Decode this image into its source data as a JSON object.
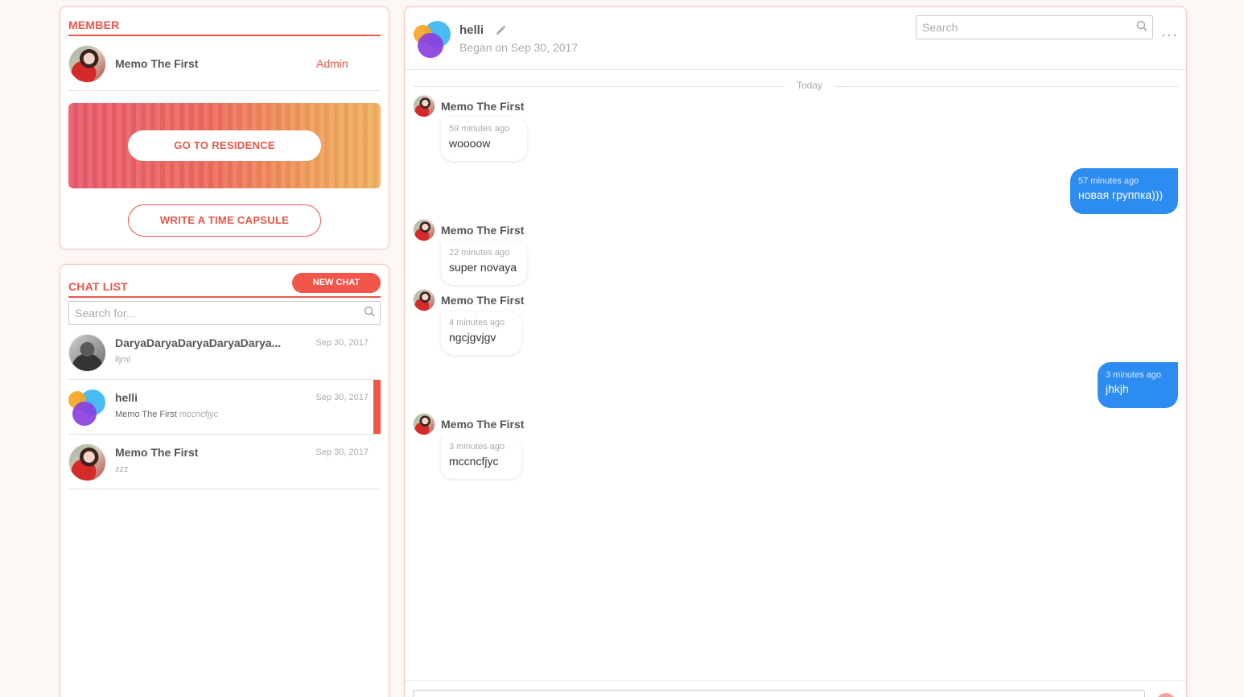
{
  "member": {
    "title": "MEMBER",
    "name": "Memo The First",
    "role": "Admin",
    "residence_button": "GO TO RESIDENCE",
    "time_capsule_button": "WRITE A TIME CAPSULE"
  },
  "chat_list": {
    "title": "CHAT LIST",
    "new_chat": "NEW CHAT",
    "search_placeholder": "Search for...",
    "items": [
      {
        "name": "DaryaDaryaDaryaDaryaDarya...",
        "date": "Sep 30, 2017",
        "sender": "",
        "preview": "lljml"
      },
      {
        "name": "helli",
        "date": "Sep 30, 2017",
        "sender": "Memo The First",
        "preview": "mccncfjyc"
      },
      {
        "name": "Memo The First",
        "date": "Sep 30, 2017",
        "sender": "",
        "preview": "zzz"
      }
    ]
  },
  "chat": {
    "title": "helli",
    "subtitle": "Began on Sep 30, 2017",
    "search_placeholder": "Search",
    "more_icon": "···",
    "day_label": "Today",
    "messages": [
      {
        "sender": "Memo The First",
        "time": "59 minutes ago",
        "text": "woooow"
      },
      {
        "sender": "",
        "time": "57 minutes ago",
        "text": "новая группка)))"
      },
      {
        "sender": "Memo The First",
        "time": "22 minutes ago",
        "text": "super novaya"
      },
      {
        "sender": "Memo The First",
        "time": "4 minutes ago",
        "text": "ngcjgvjgv"
      },
      {
        "sender": "",
        "time": "3 minutes ago",
        "text": "jhkjh"
      },
      {
        "sender": "Memo The First",
        "time": "3 minutes ago",
        "text": "mccncfjyc"
      }
    ]
  },
  "colors": {
    "accent": "#e8564a",
    "outgoing": "#2d8cf0"
  }
}
